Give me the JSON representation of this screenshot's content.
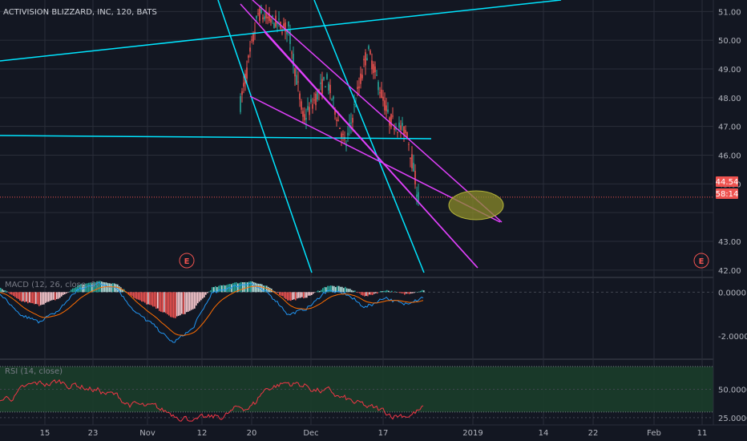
{
  "header": {
    "title": "ACTIVISION BLIZZARD, INC, 120, BATS"
  },
  "indicators": {
    "macd_title": "MACD (12, 26, close, 9)",
    "rsi_title": "RSI (14, close)"
  },
  "price_axis": {
    "labels": [
      "51.00",
      "50.00",
      "49.00",
      "48.00",
      "47.00",
      "46.00",
      "45.00",
      "43.00",
      "42.00"
    ],
    "current_price": "44.54",
    "countdown": "58:14"
  },
  "macd_axis": {
    "labels": [
      "0.0000",
      "-2.0000"
    ]
  },
  "rsi_axis": {
    "labels": [
      "50.0000",
      "25.0000"
    ]
  },
  "time_axis": {
    "labels": [
      "15",
      "23",
      "Nov",
      "12",
      "20",
      "Dec",
      "17",
      "2019",
      "14",
      "22",
      "Feb",
      "11"
    ]
  },
  "earnings_marker": {
    "label": "E"
  },
  "colors": {
    "background": "#131722",
    "grid": "#2a2e39",
    "up": "#26a69a",
    "down": "#ef5350",
    "trend_cyan": "#00e5ff",
    "trend_magenta": "#e040fb",
    "ellipse": "#8b8b2a",
    "price_badge": "#ef5350",
    "macd_line": "#2196f3",
    "signal_line": "#ff6d00",
    "rsi_line": "#f23645",
    "rsi_band": "#1b3d2a"
  },
  "chart_data": {
    "type": "candlestick",
    "title": "ACTIVISION BLIZZARD, INC, 120, BATS",
    "price_ylim": [
      41.8,
      51.4
    ],
    "visible_price_range_note": "",
    "last_price": 44.54,
    "segments": [
      {
        "name": "",
        "start": 47.8,
        "end": 50.9,
        "candles": 12,
        "volatility": 0.6
      },
      {
        "name": "",
        "start": 50.9,
        "end": 50.4,
        "candles": 18,
        "volatility": 0.5
      },
      {
        "name": "",
        "start": 50.4,
        "end": 47.3,
        "candles": 10,
        "volatility": 0.6
      },
      {
        "name": "",
        "start": 47.3,
        "end": 48.6,
        "candles": 14,
        "volatility": 0.55
      },
      {
        "name": "",
        "start": 48.6,
        "end": 46.4,
        "candles": 12,
        "volatility": 0.5
      },
      {
        "name": "",
        "start": 46.4,
        "end": 49.6,
        "candles": 14,
        "volatility": 0.6
      },
      {
        "name": "",
        "start": 49.6,
        "end": 47.2,
        "candles": 14,
        "volatility": 0.5
      },
      {
        "name": "",
        "start": 47.2,
        "end": 46.8,
        "candles": 10,
        "volatility": 0.5
      },
      {
        "name": "",
        "start": 46.8,
        "end": 44.5,
        "candles": 8,
        "volatility": 0.6
      }
    ],
    "macd_ylim": [
      -3.0,
      0.6
    ],
    "macd_hist_pattern": [
      0.2,
      -0.4,
      -0.6,
      -0.3,
      0.3,
      0.5,
      0.4,
      -0.3,
      -0.7,
      -1.2,
      -0.8,
      0.2,
      0.4,
      0.5,
      0.2,
      -0.4,
      -0.2,
      0.3,
      0.2,
      -0.2,
      0.1,
      -0.1,
      0.1
    ],
    "rsi_ylim": [
      20,
      75
    ],
    "rsi_band": [
      30,
      70
    ],
    "rsi_levels": [
      50,
      25
    ]
  }
}
